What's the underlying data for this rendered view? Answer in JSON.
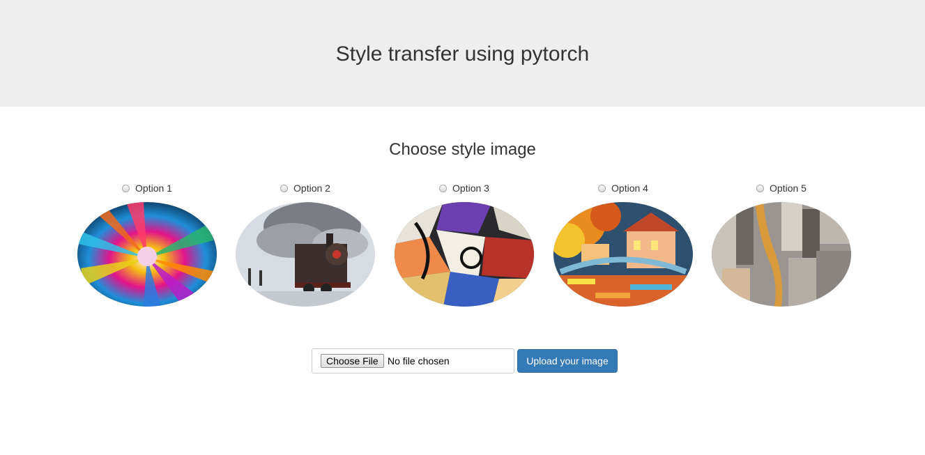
{
  "header": {
    "title": "Style transfer using pytorch"
  },
  "main": {
    "section_title": "Choose style image",
    "options": [
      {
        "label": "Option 1",
        "image": "colorful powder explosion"
      },
      {
        "label": "Option 2",
        "image": "steam locomotive painting"
      },
      {
        "label": "Option 3",
        "image": "abstract cubist painting"
      },
      {
        "label": "Option 4",
        "image": "colorful bridge and houses painting"
      },
      {
        "label": "Option 5",
        "image": "grey and ochre brushstroke painting"
      }
    ],
    "upload": {
      "choose_file_label": "Choose File",
      "file_status": "No file chosen",
      "submit_label": "Upload your image"
    }
  },
  "colors": {
    "header_bg": "#eeeeee",
    "primary_button": "#337ab7"
  }
}
